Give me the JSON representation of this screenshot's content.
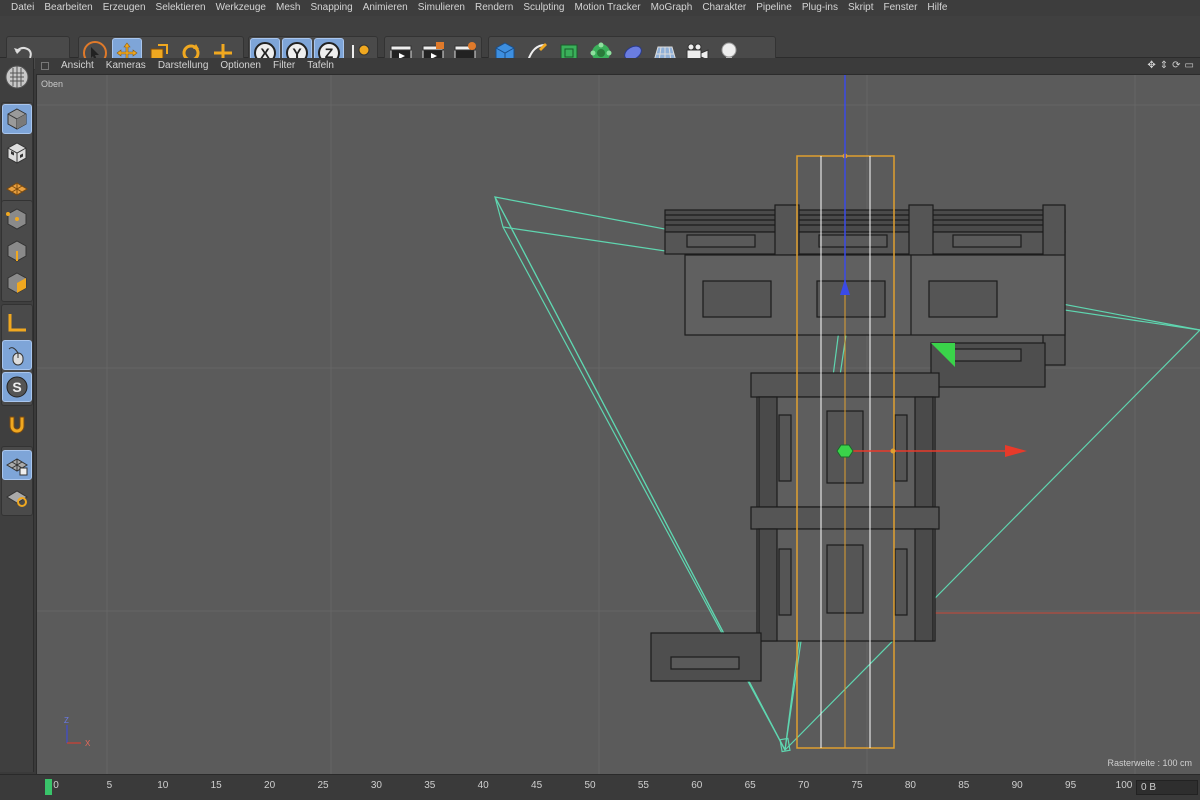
{
  "menu": [
    "Datei",
    "Bearbeiten",
    "Erzeugen",
    "Selektieren",
    "Werkzeuge",
    "Mesh",
    "Snapping",
    "Animieren",
    "Simulieren",
    "Rendern",
    "Sculpting",
    "Motion Tracker",
    "MoGraph",
    "Charakter",
    "Pipeline",
    "Plug-ins",
    "Skript",
    "Fenster",
    "Hilfe"
  ],
  "toolbar": {
    "axis_x": "X",
    "axis_y": "Y",
    "axis_z": "Z",
    "tools": [
      "undo-icon",
      "redo-icon",
      "select-icon",
      "move-icon",
      "scale-icon",
      "rotate-icon",
      "live-select-icon",
      "axis-x-icon",
      "axis-y-icon",
      "axis-z-icon",
      "coordinate-system-icon",
      "render-view-icon",
      "render-picture-viewer-icon",
      "render-settings-icon",
      "cube-primitive-icon",
      "pen-spline-icon",
      "subdivision-nurbs-icon",
      "array-mograph-icon",
      "deformer-icon",
      "floor-environment-icon",
      "camera-icon",
      "light-icon"
    ]
  },
  "left_tools": {
    "snap_label": "S",
    "tools": [
      "make-editable-icon",
      "model-mode-icon",
      "texture-mode-icon",
      "workplane-icon",
      "points-mode-icon",
      "edges-mode-icon",
      "polygons-mode-icon",
      "axis-mode-icon",
      "tweak-mode-icon",
      "snap-icon",
      "magnet-icon",
      "lock-workplane-icon",
      "workplane-align-icon"
    ]
  },
  "viewport_menu": [
    "Ansicht",
    "Kameras",
    "Darstellung",
    "Optionen",
    "Filter",
    "Tafeln"
  ],
  "viewport": {
    "name": "Oben",
    "raster": "Rasterweite : 100 cm",
    "axis_x": "X",
    "axis_z": "Z"
  },
  "timeline": {
    "ticks": [
      "0",
      "5",
      "10",
      "15",
      "20",
      "25",
      "30",
      "35",
      "40",
      "45",
      "50",
      "55",
      "60",
      "65",
      "70",
      "75",
      "80",
      "85",
      "90",
      "95",
      "100"
    ],
    "field_value": "0 B"
  },
  "colors": {
    "accent_blue": "#7ea5d8",
    "selection_orange": "#e0a030",
    "camera_cyan": "#5fd6b0",
    "axis_red": "#e83a2a",
    "axis_green": "#3ad34a",
    "axis_blue": "#3a4ae8"
  }
}
